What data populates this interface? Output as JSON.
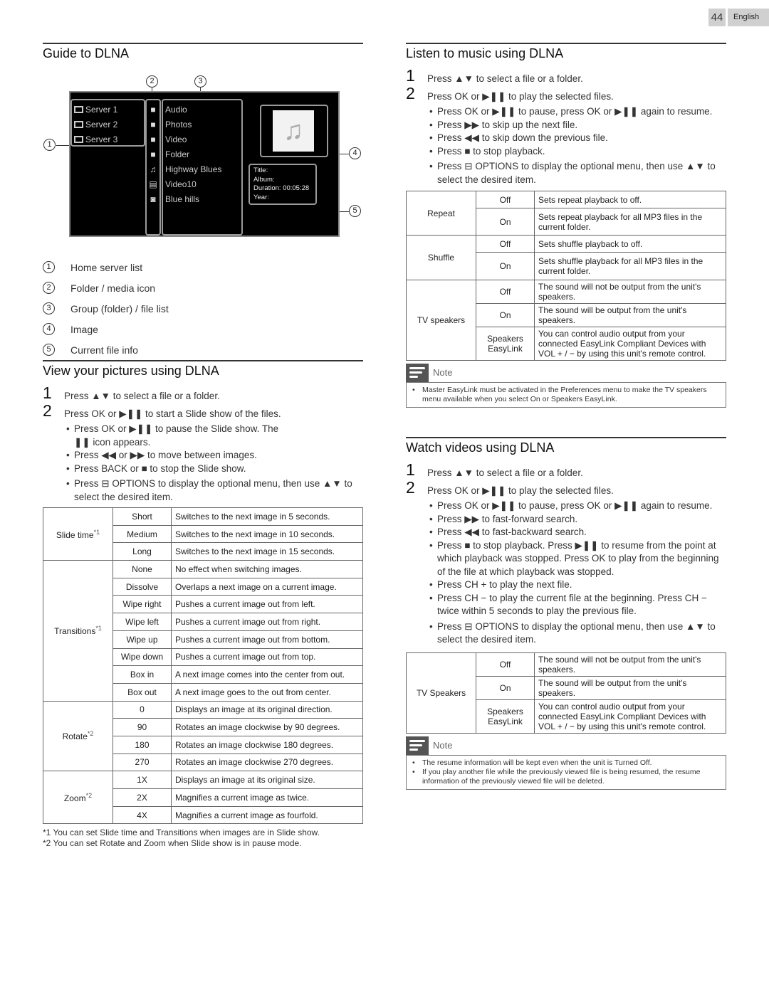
{
  "header": {
    "page_number": "44",
    "language": "English"
  },
  "guide": {
    "title": "Guide to DLNA",
    "callouts": [
      "1",
      "2",
      "3",
      "4",
      "5"
    ],
    "servers": [
      "Server 1",
      "Server 2",
      "Server 3"
    ],
    "items": [
      {
        "icon": "folder-icon",
        "label": "Audio"
      },
      {
        "icon": "folder-icon",
        "label": "Photos"
      },
      {
        "icon": "folder-icon",
        "label": "Video"
      },
      {
        "icon": "folder-icon",
        "label": "Folder"
      },
      {
        "icon": "music-note-icon",
        "label": "Highway Blues"
      },
      {
        "icon": "film-icon",
        "label": "Video10"
      },
      {
        "icon": "camera-icon",
        "label": "Blue hills"
      }
    ],
    "info": [
      "Title:",
      "Album:",
      "Duration: 00:05:28",
      "Year:"
    ],
    "legend": [
      {
        "num": "1",
        "label": "Home server list"
      },
      {
        "num": "2",
        "label": "Folder / media icon"
      },
      {
        "num": "3",
        "label": "Group (folder) / file list"
      },
      {
        "num": "4",
        "label": "Image"
      },
      {
        "num": "5",
        "label": "Current file info"
      }
    ]
  },
  "pictures": {
    "title": "View your pictures using DLNA",
    "step1": {
      "num": "1",
      "text": "Press ▲▼ to select a file or a folder."
    },
    "step2": {
      "num": "2",
      "text": "Press OK or ▶❚❚ to start a Slide show of the files."
    },
    "bullets": [
      "Press OK or ▶❚❚ to pause the Slide show. The ❚❚ icon appears.",
      "Press ◀◀ or ▶▶ to move between images.",
      "Press BACK or ■ to stop the Slide show.",
      "Press ⊟ OPTIONS to display the optional menu, then use ▲▼ to select the desired item."
    ],
    "table": [
      {
        "group": "Slide time",
        "mark": "*1",
        "rows": [
          [
            "Short",
            "Switches to the next image in 5 seconds."
          ],
          [
            "Medium",
            "Switches to the next image in 10 seconds."
          ],
          [
            "Long",
            "Switches to the next image in 15 seconds."
          ]
        ]
      },
      {
        "group": "Transitions",
        "mark": "*1",
        "rows": [
          [
            "None",
            "No effect when switching images."
          ],
          [
            "Dissolve",
            "Overlaps a next image on a current image."
          ],
          [
            "Wipe right",
            "Pushes a current image out from left."
          ],
          [
            "Wipe left",
            "Pushes a current image out from right."
          ],
          [
            "Wipe up",
            "Pushes a current image out from bottom."
          ],
          [
            "Wipe down",
            "Pushes a current image out from top."
          ],
          [
            "Box in",
            "A next image comes into the center from out."
          ],
          [
            "Box out",
            "A next image goes to the out from center."
          ]
        ]
      },
      {
        "group": "Rotate",
        "mark": "*2",
        "rows": [
          [
            "0",
            "Displays an image at its original direction."
          ],
          [
            "90",
            "Rotates an image clockwise by 90 degrees."
          ],
          [
            "180",
            "Rotates an image clockwise 180 degrees."
          ],
          [
            "270",
            "Rotates an image clockwise 270 degrees."
          ]
        ]
      },
      {
        "group": "Zoom",
        "mark": "*2",
        "rows": [
          [
            "1X",
            "Displays an image at its original size."
          ],
          [
            "2X",
            "Magnifies a current image as twice."
          ],
          [
            "4X",
            "Magnifies a current image as fourfold."
          ]
        ]
      }
    ],
    "footnotes": [
      "*1 You can set Slide time and Transitions when images are in Slide show.",
      "*2 You can set Rotate and Zoom when Slide show is in pause mode."
    ]
  },
  "music": {
    "title": "Listen to music using DLNA",
    "step1": {
      "num": "1",
      "text": "Press ▲▼ to select a file or a folder."
    },
    "step2": {
      "num": "2",
      "text": "Press OK or ▶❚❚ to play the selected files."
    },
    "bullets": [
      "Press OK or ▶❚❚ to pause, press OK or ▶❚❚ again to resume.",
      "Press ▶▶ to skip up the next file.",
      "Press ◀◀ to skip down the previous file.",
      "Press ■ to stop playback.",
      "Press ⊟ OPTIONS to display the optional menu, then use ▲▼ to select the desired item."
    ],
    "table": [
      {
        "group": "Repeat",
        "rows": [
          [
            "Off",
            "Sets repeat playback to off."
          ],
          [
            "On",
            "Sets repeat playback for all MP3 files in the current folder."
          ]
        ]
      },
      {
        "group": "Shuffle",
        "rows": [
          [
            "Off",
            "Sets shuffle playback to off."
          ],
          [
            "On",
            "Sets shuffle playback for all MP3 files in the current folder."
          ]
        ]
      },
      {
        "group": "TV speakers",
        "rows": [
          [
            "Off",
            "The sound will not be output from the unit's speakers."
          ],
          [
            "On",
            "The sound will be output from the unit's speakers."
          ],
          [
            "Speakers EasyLink",
            "You can control audio output from your connected EasyLink Compliant Devices with VOL + / − by using this unit's remote control."
          ]
        ]
      }
    ],
    "note_label": "Note",
    "notes": [
      "Master EasyLink must be activated in the Preferences menu to make the TV speakers menu available when you select On or Speakers EasyLink."
    ]
  },
  "video": {
    "title": "Watch videos using DLNA",
    "step1": {
      "num": "1",
      "text": "Press ▲▼ to select a file or a folder."
    },
    "step2": {
      "num": "2",
      "text": "Press OK or ▶❚❚ to play the selected files."
    },
    "bullets": [
      "Press OK or ▶❚❚ to pause, press OK or ▶❚❚ again to resume.",
      "Press ▶▶ to fast-forward search.",
      "Press ◀◀ to fast-backward search.",
      "Press ■ to stop playback. Press ▶❚❚ to resume from the point at which playback was stopped. Press OK to play from the beginning of the file at which playback was stopped.",
      "Press CH + to play the next file.",
      "Press CH − to play the current file at the beginning. Press CH − twice within 5 seconds to play the previous file.",
      "Press ⊟ OPTIONS to display the optional menu, then use ▲▼ to select the desired item."
    ],
    "table": [
      {
        "group": "TV Speakers",
        "rows": [
          [
            "Off",
            "The sound will not be output from the unit's speakers."
          ],
          [
            "On",
            "The sound will be output from the unit's speakers."
          ],
          [
            "Speakers EasyLink",
            "You can control audio output from your connected EasyLink Compliant Devices with VOL + / − by using this unit's remote control."
          ]
        ]
      }
    ],
    "note_label": "Note",
    "notes": [
      "The resume information will be kept even when the unit is Turned Off.",
      "If you play another file while the previously viewed file is being resumed, the resume information of the previously viewed file will be deleted."
    ]
  }
}
